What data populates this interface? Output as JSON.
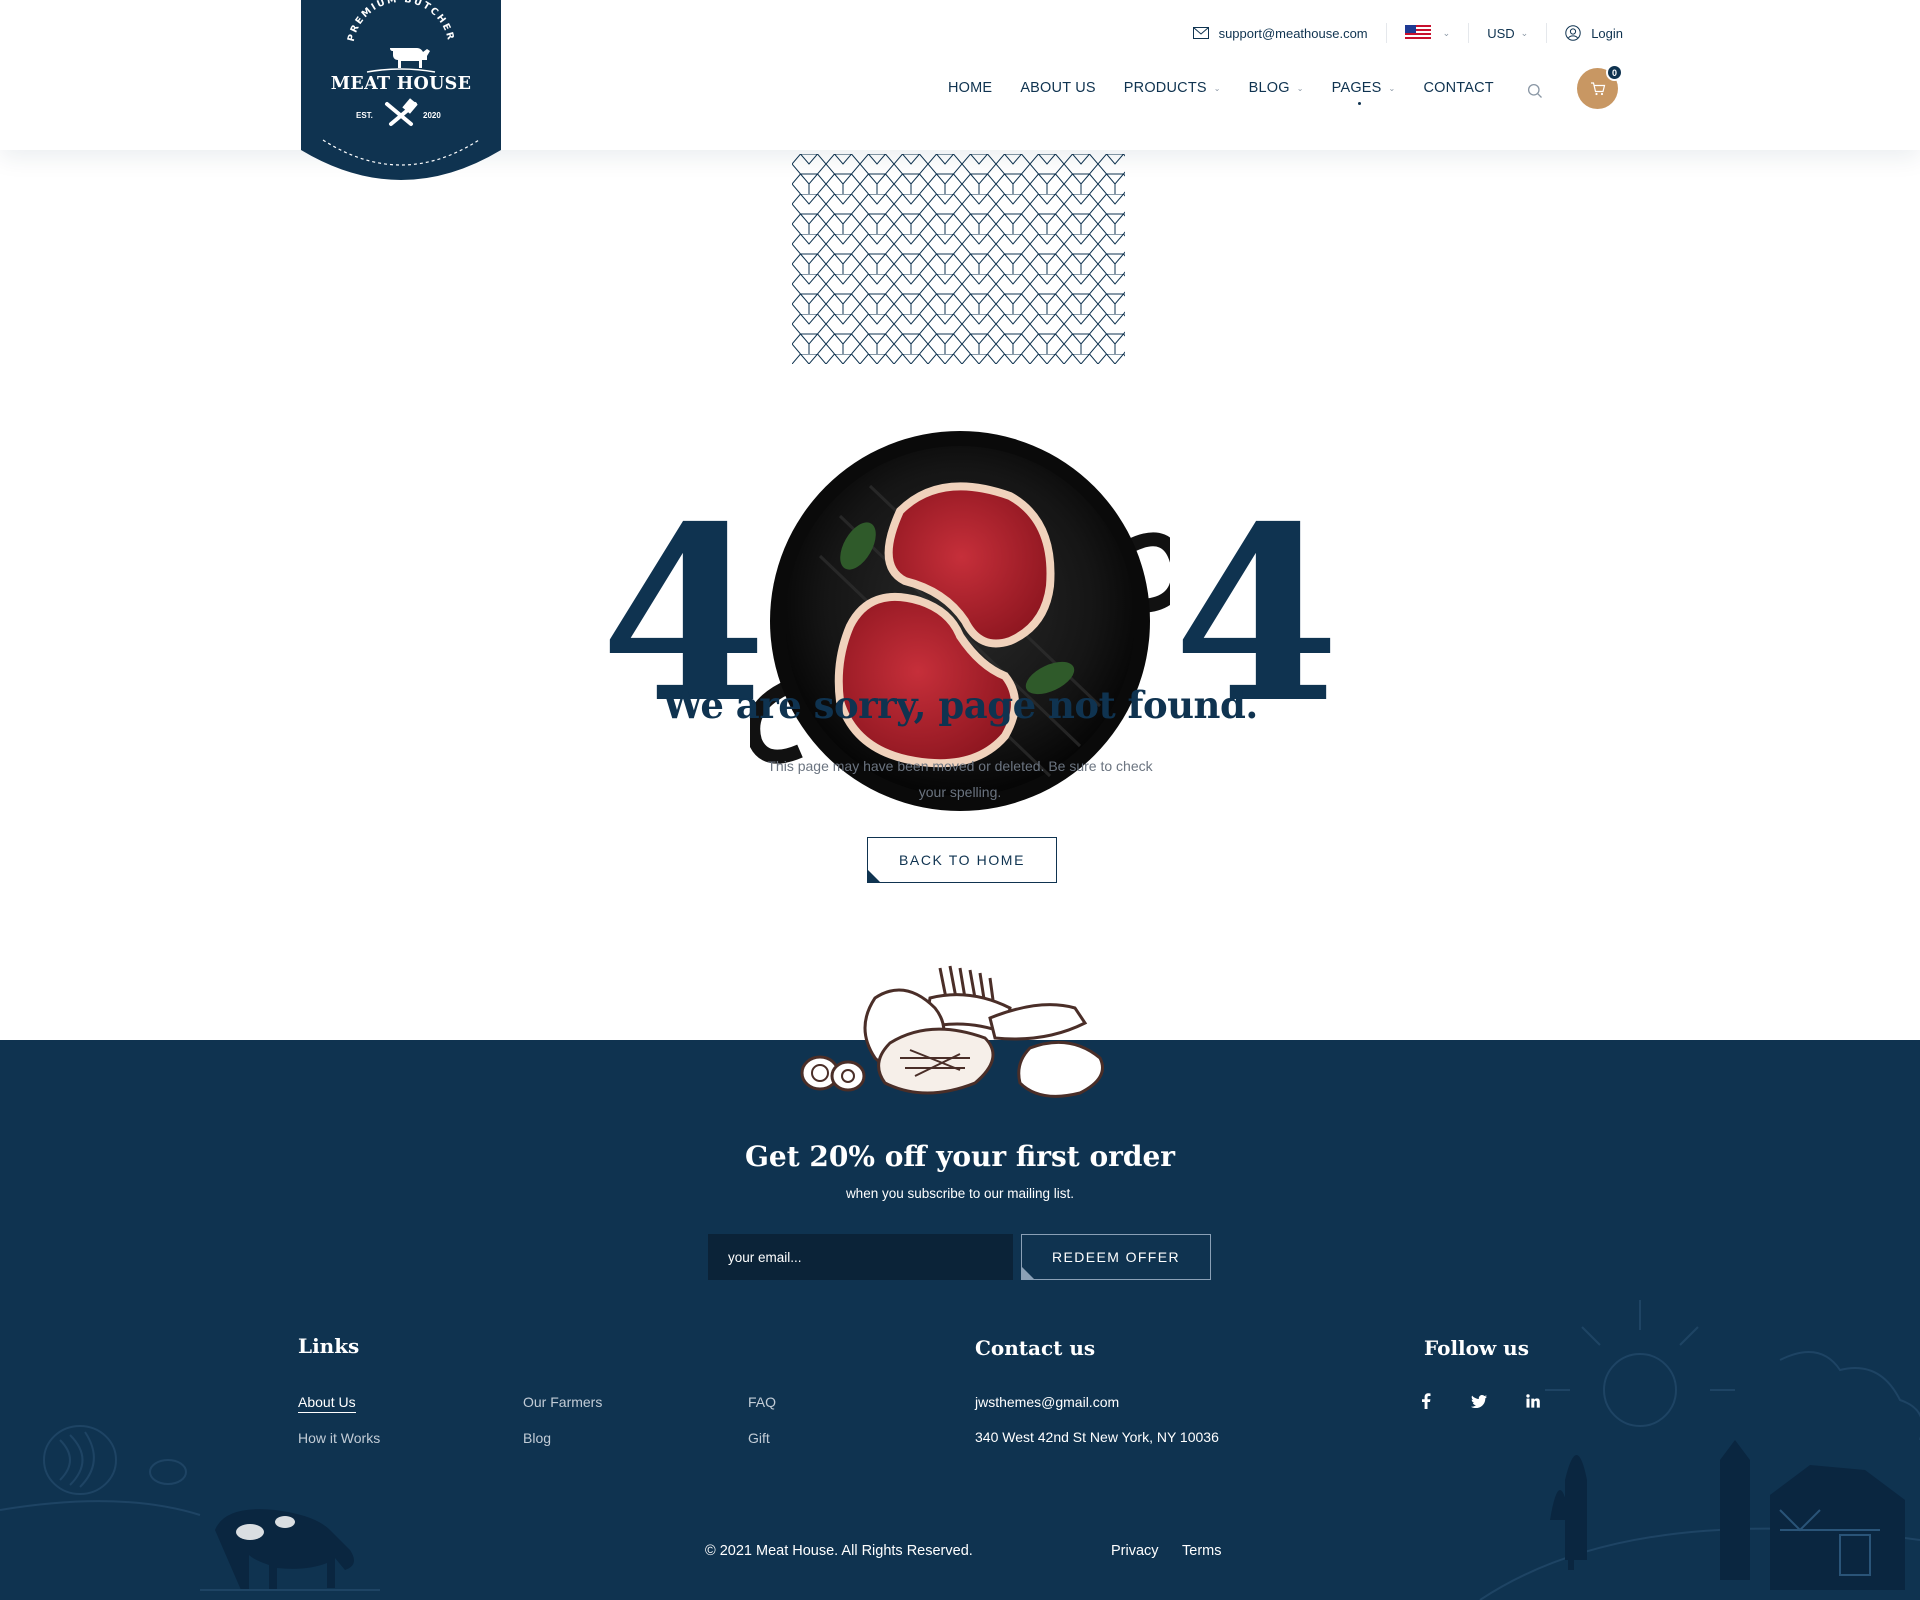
{
  "brand": {
    "arc_text": "PREMIUM BUTCHER",
    "name": "MEAT HOUSE",
    "est": "EST.",
    "year": "2020"
  },
  "topbar": {
    "email": "support@meathouse.com",
    "currency": "USD",
    "login": "Login"
  },
  "nav": {
    "items": [
      {
        "label": "HOME",
        "dropdown": false
      },
      {
        "label": "ABOUT US",
        "dropdown": false
      },
      {
        "label": "PRODUCTS",
        "dropdown": true
      },
      {
        "label": "BLOG",
        "dropdown": true
      },
      {
        "label": "PAGES",
        "dropdown": true,
        "active": true
      },
      {
        "label": "CONTACT",
        "dropdown": false
      }
    ],
    "cart_count": "0"
  },
  "error": {
    "digit_left": "4",
    "digit_right": "4",
    "title": "We are sorry, page not found.",
    "message": "This page may have been moved or deleted. Be sure to check your spelling.",
    "button": "BACK TO HOME"
  },
  "newsletter": {
    "title": "Get 20% off your first order",
    "subtitle": "when you subscribe to our mailing list.",
    "placeholder": "your email...",
    "button": "REDEEM OFFER"
  },
  "footer": {
    "links_title": "Links",
    "links": [
      "About Us",
      "Our Farmers",
      "FAQ",
      "How it Works",
      "Blog",
      "Gift"
    ],
    "contact_title": "Contact us",
    "contact_email": "jwsthemes@gmail.com",
    "contact_address": "340 West 42nd St New York, NY 10036",
    "follow_title": "Follow us",
    "social": [
      "facebook-icon",
      "twitter-icon",
      "linkedin-icon"
    ],
    "copyright": "© 2021 Meat House. All Rights Reserved.",
    "privacy": "Privacy",
    "terms": "Terms"
  },
  "colors": {
    "navy": "#0f3350",
    "accent": "#c89763",
    "input_bg": "#0b2338"
  }
}
